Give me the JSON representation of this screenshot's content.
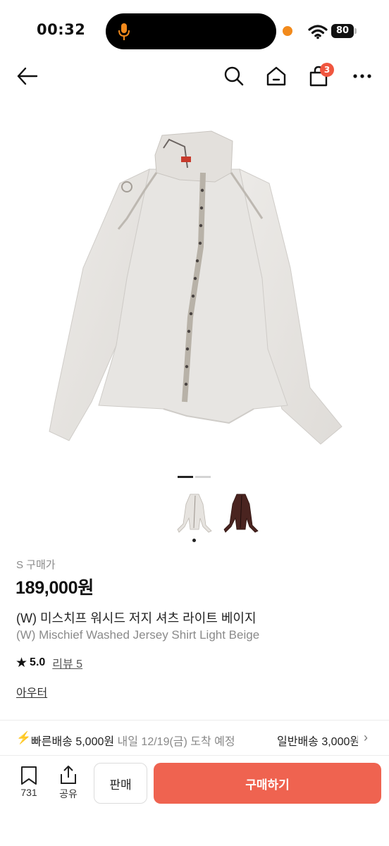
{
  "status_bar": {
    "time": "00:32",
    "battery": "80"
  },
  "header": {
    "cart_count": "3",
    "icons": [
      "back-arrow-icon",
      "search-icon",
      "home-icon",
      "cart-icon",
      "more-icon"
    ]
  },
  "gallery": {
    "pages": 2,
    "current_page": 1,
    "thumbnails": [
      "light-beige-shirt",
      "brown-shirt"
    ]
  },
  "product": {
    "size_label": "S 구매가",
    "price": "189,000원",
    "name_ko": "(W) 미스치프 워시드 저지 셔츠 라이트 베이지",
    "name_en": "(W) Mischief Washed Jersey Shirt Light Beige",
    "rating": "5.0",
    "reviews": "리뷰 5",
    "category": "아우터"
  },
  "shipping": {
    "fast_label": "빠른배송 5,000원",
    "fast_date": "내일 12/19(금) 도착 예정",
    "normal_label": "일반배송 3,000원",
    "colors": {
      "bolt": "#19c36b"
    }
  },
  "bottom_bar": {
    "bookmark_count": "731",
    "share_label": "공유",
    "sell_label": "판매",
    "buy_label": "구매하기",
    "colors": {
      "buy": "#ef6350"
    }
  }
}
